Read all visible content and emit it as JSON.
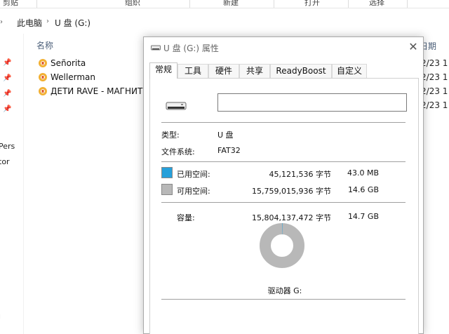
{
  "ribbon": {
    "groups": [
      "剪贴板",
      "组织",
      "新建",
      "打开",
      "选择"
    ]
  },
  "address": {
    "crumbs": [
      "此电脑",
      "U 盘 (G:)"
    ]
  },
  "nav": {
    "items": [
      "Pers",
      "tor",
      "ı"
    ]
  },
  "list": {
    "col_name": "名称",
    "col_date": "日期",
    "rows": [
      {
        "name": "Señorita",
        "date": "/2/23 1"
      },
      {
        "name": "Wellerman",
        "date": "/2/23 1"
      },
      {
        "name": "ДЕТИ RAVE - МАГНИТОЛА",
        "date": "/2/23 1"
      },
      {
        "name": "",
        "date": "/2/23 1"
      }
    ]
  },
  "dialog": {
    "title": "U 盘 (G:) 属性",
    "close": "✕",
    "tabs": [
      "常规",
      "工具",
      "硬件",
      "共享",
      "ReadyBoost",
      "自定义"
    ],
    "name_value": "",
    "type_label": "类型:",
    "type_value": "U 盘",
    "fs_label": "文件系统:",
    "fs_value": "FAT32",
    "used_label": "已用空间:",
    "used_bytes": "45,121,536 字节",
    "used_size": "43.0 MB",
    "free_label": "可用空间:",
    "free_bytes": "15,759,015,936 字节",
    "free_size": "14.6 GB",
    "capacity_label": "容量:",
    "capacity_bytes": "15,804,137,472 字节",
    "capacity_size": "14.7 GB",
    "drive_label": "驱动器 G:",
    "colors": {
      "used": "#26a0da",
      "free": "#b8b8b8"
    },
    "used_fraction": 0.00286
  }
}
